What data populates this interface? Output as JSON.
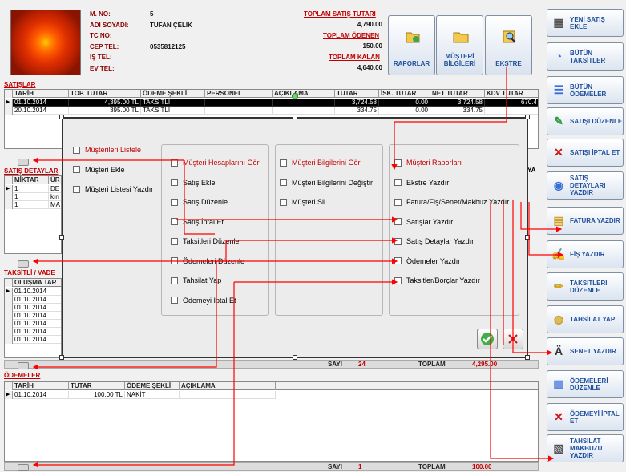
{
  "customer": {
    "labels": [
      "M. NO:",
      "ADI SOYADI:",
      "TC NO:",
      "CEP TEL:",
      "İŞ TEL:",
      "EV TEL:"
    ],
    "values": [
      "5",
      "TUFAN ÇELİK",
      "",
      "0535812125",
      "",
      ""
    ]
  },
  "totals": {
    "sales_label": "TOPLAM SATIŞ TUTARI",
    "sales_value": "4,790.00",
    "paid_label": "TOPLAM ÖDENEN",
    "paid_value": "150.00",
    "remaining_label": "TOPLAM KALAN",
    "remaining_value": "4,640.00"
  },
  "top_buttons": {
    "reports": "RAPORLAR",
    "customer_info": "MÜŞTERİ BİLGİLERİ",
    "statement": "EKSTRE"
  },
  "right_buttons": [
    "YENİ SATIŞ EKLE",
    "BÜTÜN TAKSİTLER",
    "BÜTÜN ÖDEMELER",
    "SATIŞI DÜZENLE",
    "SATIŞI İPTAL ET",
    "SATIŞ DETAYLARI YAZDIR",
    "FATURA YAZDIR",
    "FİŞ YAZDIR",
    "TAKSİTLERİ DÜZENLE",
    "TAHSİLAT YAP",
    "SENET YAZDIR",
    "ÖDEMELERİ DÜZENLE",
    "ÖDEMEYİ İPTAL ET",
    "TAHSİLAT MAKBUZU YAZDIR"
  ],
  "sections": {
    "sales": "SATIŞLAR",
    "sale_details": "SATIŞ DETAYLAR",
    "installments": "TAKSİTLİ / VADE",
    "payments": "ÖDEMELER"
  },
  "sales_grid": {
    "headers": [
      "TARİH",
      "TOP. TUTAR",
      "ÖDEME ŞEKLİ",
      "PERSONEL",
      "AÇIKLAMA",
      "TUTAR",
      "İSK. TUTAR",
      "NET TUTAR",
      "KDV TUTAR"
    ],
    "rows": [
      [
        "01.10.2014",
        "4,395.00 TL",
        "TAKSİTLİ",
        "",
        "",
        "3,724.58",
        "0.00",
        "3,724.58",
        "670.4"
      ],
      [
        "20.10.2014",
        "395.00 TL",
        "TAKSİTLİ",
        "",
        "",
        "334.75",
        "0.00",
        "334.75",
        ""
      ]
    ]
  },
  "details_grid": {
    "headers": [
      "MİKTAR",
      "ÜR"
    ],
    "rows": [
      [
        "1",
        "DE"
      ],
      [
        "1",
        "kırı"
      ],
      [
        "1",
        "MA"
      ]
    ]
  },
  "installments_grid": {
    "headers": [
      "OLUŞMA TAR"
    ],
    "rows": [
      "01.10.2014",
      "01.10.2014",
      "01.10.2014",
      "01.10.2014",
      "01.10.2014",
      "01.10.2014",
      "01.10.2014"
    ]
  },
  "installments_footer": {
    "count_label": "SAYI",
    "count": "24",
    "total_label": "TOPLAM",
    "total": "4,295.00"
  },
  "ya_fragment": "YA",
  "payments_grid": {
    "headers": [
      "TARİH",
      "TUTAR",
      "ÖDEME ŞEKLİ",
      "AÇIKLAMA"
    ],
    "rows": [
      [
        "01.10.2014",
        "100.00 TL",
        "NAKİT",
        ""
      ]
    ]
  },
  "payments_footer": {
    "count_label": "SAYI",
    "count": "1",
    "total_label": "TOPLAM",
    "total": "100.00"
  },
  "dialog": {
    "col1": [
      "Müşterileri Listele",
      "Müşteri Ekle",
      "Müşteri Listesi Yazdır"
    ],
    "col2": [
      "Müşteri Hesaplarını Gör",
      "Satış Ekle",
      "Satış Düzenle",
      "Satış İptal Et",
      "Taksitleri Düzenle",
      "Ödemeleri Düzenle",
      "Tahsilat Yap",
      "Ödemeyi İptal Et"
    ],
    "col3": [
      "Müşteri Bilgilerini Gör",
      "Müşteri Bilgilerini Değiştir",
      "Müşteri Sil"
    ],
    "col4": [
      "Müşteri Raporları",
      "Ekstre Yazdır",
      "Fatura/Fiş/Senet/Makbuz Yazdır",
      "Satışlar Yazdır",
      "Satış Detaylar Yazdır",
      "Ödemeler Yazdır",
      "Taksitler/Borçlar Yazdır"
    ]
  },
  "colors": {
    "accent_red": "#c00000",
    "arrow_red": "#ff0000",
    "button_text": "#1f4f9c"
  }
}
